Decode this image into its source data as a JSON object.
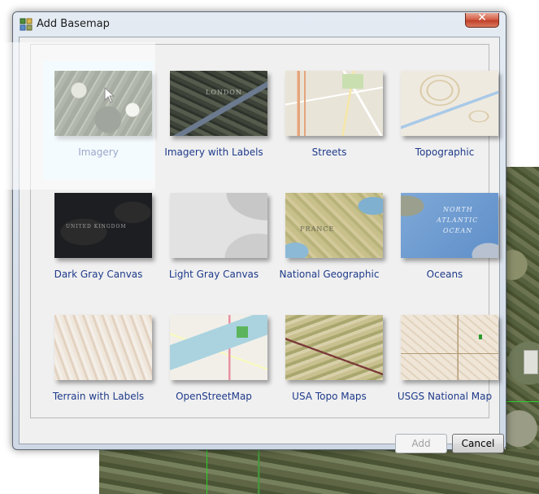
{
  "dialog": {
    "title": "Add Basemap",
    "close_symbol": "✕"
  },
  "basemaps": [
    {
      "label": "Imagery",
      "selected": true
    },
    {
      "label": "Imagery with Labels",
      "selected": false
    },
    {
      "label": "Streets",
      "selected": false
    },
    {
      "label": "Topographic",
      "selected": false
    },
    {
      "label": "Dark Gray Canvas",
      "selected": false
    },
    {
      "label": "Light Gray Canvas",
      "selected": false
    },
    {
      "label": "National Geographic",
      "selected": false
    },
    {
      "label": "Oceans",
      "selected": false
    },
    {
      "label": "Terrain with Labels",
      "selected": false
    },
    {
      "label": "OpenStreetMap",
      "selected": false
    },
    {
      "label": "USA Topo Maps",
      "selected": false
    },
    {
      "label": "USGS National Map",
      "selected": false
    }
  ],
  "thumb_text": {
    "london": "LONDON",
    "north_atlantic_1": "NORTH",
    "north_atlantic_2": "ATLANTIC",
    "north_atlantic_3": "OCEAN",
    "france": "FRANCE",
    "united_kingdom": "UNITED KINGDOM"
  },
  "buttons": {
    "add": "Add",
    "add_enabled": false,
    "cancel": "Cancel"
  },
  "colors": {
    "label_text": "#1e3a8a",
    "selected_tile": "#e7f6fd",
    "close_button": "#c2402a"
  }
}
